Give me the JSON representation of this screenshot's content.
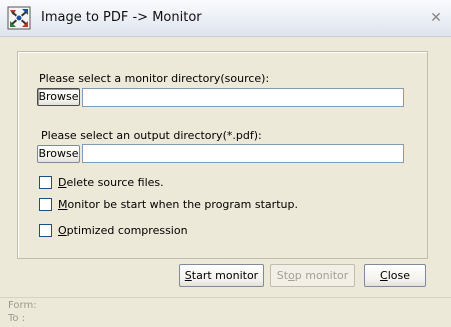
{
  "window": {
    "title": "Image to PDF -> Monitor",
    "close_glyph": "✕"
  },
  "source": {
    "label": "Please select a monitor directory(source):",
    "browse_label": "Browse",
    "value": ""
  },
  "output": {
    "label": "Please select an output directory(*.pdf):",
    "browse_label": "Browse",
    "value": ""
  },
  "options": [
    {
      "label": "Delete source files.",
      "accel": "D",
      "rest": "elete source files.",
      "checked": false
    },
    {
      "label": "Monitor be start when the program startup.",
      "accel": "M",
      "rest": "onitor be start when the program startup.",
      "checked": false
    },
    {
      "label": "Optimized compression",
      "accel": "O",
      "rest": "ptimized compression",
      "checked": false
    }
  ],
  "buttons": {
    "start": {
      "label": "Start monitor",
      "accel": "S",
      "rest": "tart monitor",
      "enabled": true
    },
    "stop": {
      "label": "Stop monitor",
      "pre": "St",
      "accel": "o",
      "rest": "p monitor",
      "enabled": false
    },
    "close": {
      "label": "Close",
      "accel": "C",
      "rest": "lose",
      "enabled": true
    }
  },
  "status": {
    "from_label": "Form:",
    "to_label": "To  :"
  },
  "icons": {
    "app": "image-to-pdf-app-icon",
    "close": "close-icon"
  }
}
